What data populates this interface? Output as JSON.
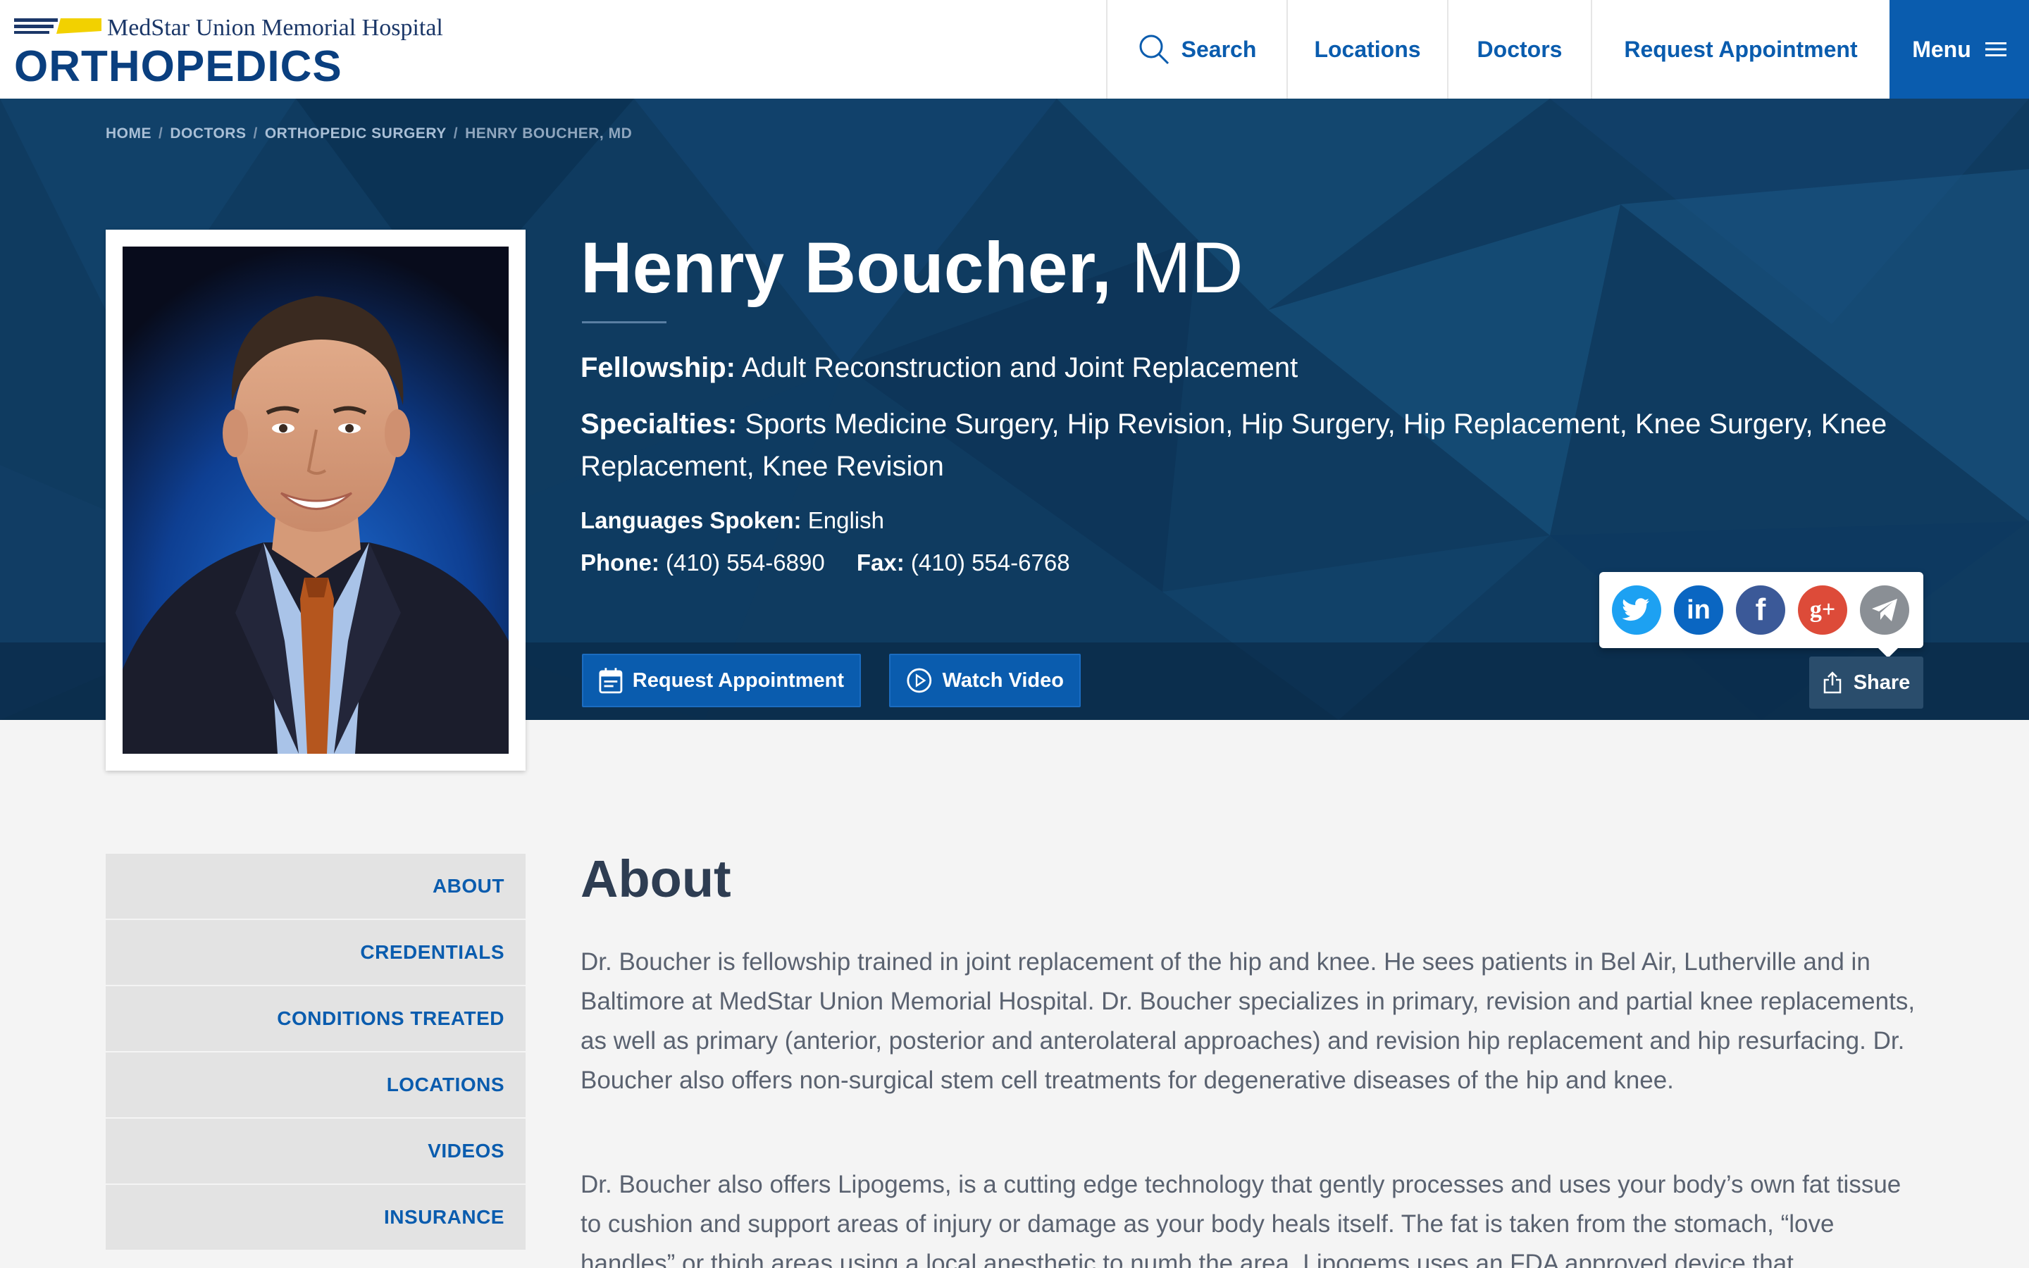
{
  "header": {
    "hospital_name": "MedStar Union Memorial Hospital",
    "department": "ORTHOPEDICS",
    "nav": {
      "search": "Search",
      "locations": "Locations",
      "doctors": "Doctors",
      "request": "Request Appointment",
      "menu": "Menu"
    }
  },
  "breadcrumb": [
    "HOME",
    "DOCTORS",
    "ORTHOPEDIC SURGERY",
    "HENRY BOUCHER, MD"
  ],
  "profile": {
    "name": "Henry Boucher,",
    "credential": "MD",
    "fellowship_label": "Fellowship:",
    "fellowship": "Adult Reconstruction and Joint Replacement",
    "specialties_label": "Specialties:",
    "specialties": "Sports Medicine Surgery, Hip Revision, Hip Surgery, Hip Replacement, Knee Surgery, Knee Replacement, Knee Revision",
    "languages_label": "Languages Spoken:",
    "languages": "English",
    "phone_label": "Phone:",
    "phone": "(410) 554-6890",
    "fax_label": "Fax:",
    "fax": "(410) 554-6768"
  },
  "actions": {
    "request_appointment": "Request Appointment",
    "watch_video": "Watch Video",
    "share": "Share"
  },
  "share_icons": [
    "twitter-icon",
    "linkedin-icon",
    "facebook-icon",
    "google-plus-icon",
    "send-icon"
  ],
  "sidenav": [
    "ABOUT",
    "CREDENTIALS",
    "CONDITIONS TREATED",
    "LOCATIONS",
    "VIDEOS",
    "INSURANCE"
  ],
  "about": {
    "title": "About",
    "paragraph1": "Dr. Boucher is fellowship trained in joint replacement of the hip and knee. He sees patients in Bel Air, Lutherville and in Baltimore at MedStar Union Memorial Hospital. Dr. Boucher specializes in primary, revision and partial knee replacements, as well as primary (anterior, posterior and anterolateral approaches) and revision hip replacement and hip resurfacing. Dr. Boucher also offers non-surgical stem cell treatments for degenerative diseases of the hip and knee.",
    "paragraph2": "Dr. Boucher also offers Lipogems, is a cutting edge technology that gently processes and uses your body’s own fat tissue to cushion and support areas of injury or damage as your body heals itself. The fat is taken from the stomach, “love handles” or thigh areas using a local anesthetic to numb the area. Lipogems uses an FDA approved device that"
  },
  "colors": {
    "brand_blue": "#0a5cae",
    "navy": "#0e3a5e",
    "logo_yellow": "#f2d100"
  }
}
